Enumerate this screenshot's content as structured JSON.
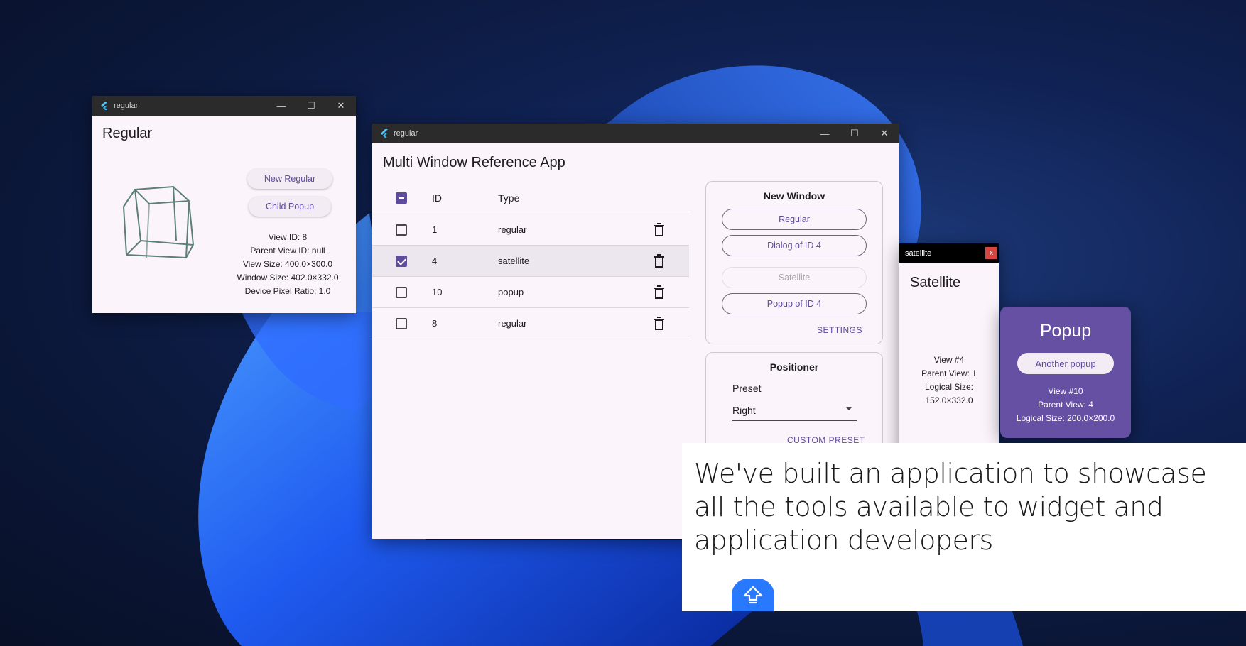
{
  "regular_window": {
    "title": "regular",
    "heading": "Regular",
    "buttons": {
      "new_regular": "New Regular",
      "child_popup": "Child Popup"
    },
    "info": {
      "view_id": "View ID: 8",
      "parent_view_id": "Parent View ID: null",
      "view_size": "View Size: 400.0×300.0",
      "window_size": "Window Size: 402.0×332.0",
      "device_pixel_ratio": "Device Pixel Ratio: 1.0"
    }
  },
  "main_window": {
    "title": "regular",
    "app_title": "Multi Window Reference App",
    "table": {
      "headers": {
        "id": "ID",
        "type": "Type"
      },
      "rows": [
        {
          "id": "1",
          "type": "regular",
          "checked": false
        },
        {
          "id": "4",
          "type": "satellite",
          "checked": true
        },
        {
          "id": "10",
          "type": "popup",
          "checked": false
        },
        {
          "id": "8",
          "type": "regular",
          "checked": false
        }
      ]
    },
    "new_window": {
      "title": "New Window",
      "buttons": [
        "Regular",
        "Dialog of ID 4",
        "Satellite",
        "Popup of ID 4"
      ],
      "settings": "SETTINGS"
    },
    "positioner": {
      "title": "Positioner",
      "preset_label": "Preset",
      "preset_value": "Right",
      "custom_preset": "CUSTOM PRESET"
    }
  },
  "satellite_window": {
    "title": "satellite",
    "close": "x",
    "heading": "Satellite",
    "info": {
      "view": "View #4",
      "parent_view": "Parent View: 1",
      "logical_size_label": "Logical Size:",
      "logical_size_value": "152.0×332.0"
    }
  },
  "popup_window": {
    "heading": "Popup",
    "button": "Another popup",
    "info": {
      "view": "View #10",
      "parent_view": "Parent View: 4",
      "logical_size": "Logical Size: 200.0×200.0"
    }
  },
  "caption": {
    "text": "We've built an application to showcase all the tools available to widget and application developers"
  },
  "icons": {
    "app_logo": "flutter-logo-icon",
    "minimize": "minimize-icon",
    "maximize": "maximize-icon",
    "close": "close-icon",
    "delete": "trash-icon",
    "dropdown": "caret-down-icon",
    "fab": "upload-arrow-icon"
  },
  "colors": {
    "accent": "#5e4b9c",
    "popup_bg": "#6650a4",
    "window_bg": "#fbf5fb",
    "titlebar": "#2b2b2b",
    "fab": "#2979ff"
  }
}
